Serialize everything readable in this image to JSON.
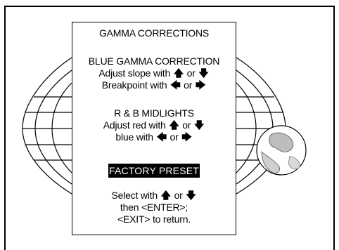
{
  "menu": {
    "title": "GAMMA CORRECTIONS",
    "section_blue": {
      "heading": "BLUE GAMMA CORRECTION",
      "slope_text": "Adjust slope with",
      "breakpoint_text": "Breakpoint with",
      "or": "or"
    },
    "section_rb": {
      "heading": "R & B MIDLIGHTS",
      "red_text": "Adjust red with",
      "blue_text": "blue with",
      "or": "or"
    },
    "selected_item": "FACTORY PRESET",
    "instructions": {
      "select_text": "Select with",
      "or": "or",
      "line2": "then <ENTER>;",
      "line3": "<EXIT> to return."
    }
  },
  "glyphs": {
    "up": "🡅",
    "down": "🡇",
    "left": "🡄",
    "right": "🡆"
  },
  "background": {
    "graphic": "globe-icon"
  }
}
